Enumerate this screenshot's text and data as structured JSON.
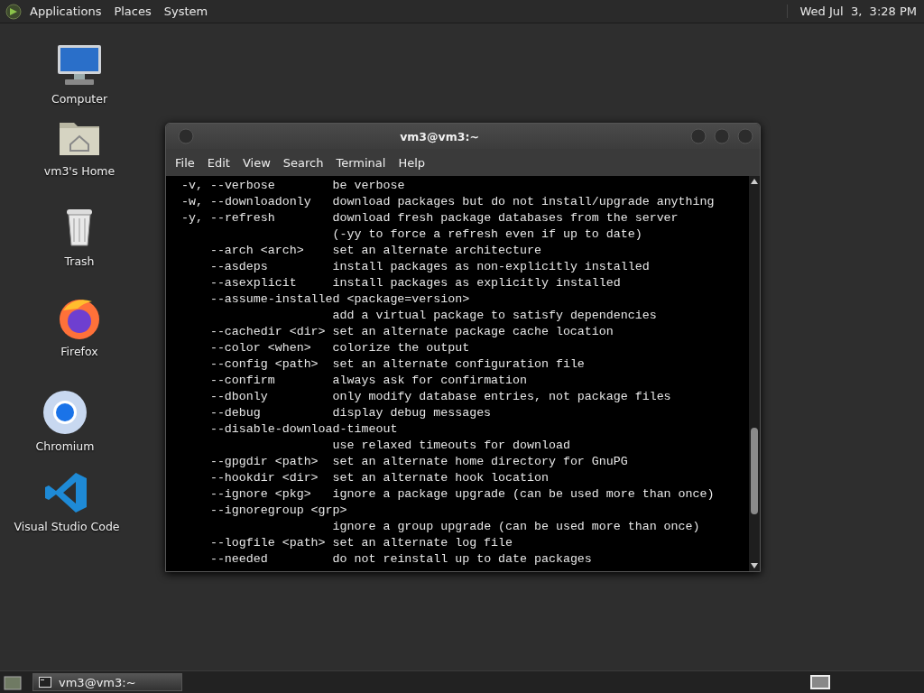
{
  "top_panel": {
    "menus": [
      "Applications",
      "Places",
      "System"
    ],
    "clock": "Wed Jul  3,  3:28 PM"
  },
  "desktop_icons": [
    {
      "kind": "computer",
      "label": "Computer"
    },
    {
      "kind": "home",
      "label": "vm3's Home"
    },
    {
      "kind": "trash",
      "label": "Trash"
    },
    {
      "kind": "firefox",
      "label": "Firefox"
    },
    {
      "kind": "chromium",
      "label": "Chromium"
    },
    {
      "kind": "vscode",
      "label": "Visual Studio Code"
    }
  ],
  "window": {
    "title": "vm3@vm3:~",
    "menu": [
      "File",
      "Edit",
      "View",
      "Search",
      "Terminal",
      "Help"
    ],
    "lines": [
      {
        "kind": "short",
        "option": "-v, --verbose",
        "description": "be verbose"
      },
      {
        "kind": "short",
        "option": "-w, --downloadonly",
        "description": "download packages but do not install/upgrade anything"
      },
      {
        "kind": "short",
        "option": "-y, --refresh",
        "description": "download fresh package databases from the server"
      },
      {
        "kind": "cont",
        "description": "(-yy to force a refresh even if up to date)"
      },
      {
        "kind": "long",
        "option": "--arch <arch>",
        "description": "set an alternate architecture"
      },
      {
        "kind": "long",
        "option": "--asdeps",
        "description": "install packages as non-explicitly installed"
      },
      {
        "kind": "long",
        "option": "--asexplicit",
        "description": "install packages as explicitly installed"
      },
      {
        "kind": "long",
        "option": "--assume-installed <package=version>"
      },
      {
        "kind": "cont",
        "description": "add a virtual package to satisfy dependencies"
      },
      {
        "kind": "long",
        "option": "--cachedir <dir>",
        "description": "set an alternate package cache location"
      },
      {
        "kind": "long",
        "option": "--color <when>",
        "description": "colorize the output"
      },
      {
        "kind": "long",
        "option": "--config <path>",
        "description": "set an alternate configuration file"
      },
      {
        "kind": "long",
        "option": "--confirm",
        "description": "always ask for confirmation"
      },
      {
        "kind": "long",
        "option": "--dbonly",
        "description": "only modify database entries, not package files"
      },
      {
        "kind": "long",
        "option": "--debug",
        "description": "display debug messages"
      },
      {
        "kind": "long",
        "option": "--disable-download-timeout"
      },
      {
        "kind": "cont",
        "description": "use relaxed timeouts for download"
      },
      {
        "kind": "long",
        "option": "--gpgdir <path>",
        "description": "set an alternate home directory for GnuPG"
      },
      {
        "kind": "long",
        "option": "--hookdir <dir>",
        "description": "set an alternate hook location"
      },
      {
        "kind": "long",
        "option": "--ignore <pkg>",
        "description": "ignore a package upgrade (can be used more than once)"
      },
      {
        "kind": "long",
        "option": "--ignoregroup <grp>"
      },
      {
        "kind": "cont",
        "description": "ignore a group upgrade (can be used more than once)"
      },
      {
        "kind": "long",
        "option": "--logfile <path>",
        "description": "set an alternate log file"
      },
      {
        "kind": "long",
        "option": "--needed",
        "description": "do not reinstall up to date packages"
      }
    ]
  },
  "taskbar": {
    "tasks": [
      {
        "label": "vm3@vm3:~",
        "selected": true
      }
    ]
  }
}
